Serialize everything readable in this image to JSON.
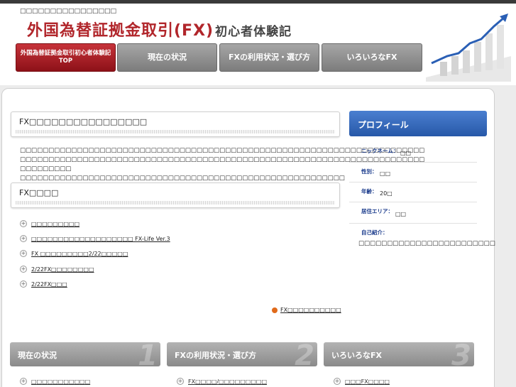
{
  "header": {
    "tagline": "□□□□□□□□□□□□□□□□",
    "logo_main": "外国為替証拠金取引(FX)",
    "logo_sub": "初心者体験記"
  },
  "nav": [
    {
      "label": "外国為替証拠金取引初心者体験記 TOP",
      "active": true
    },
    {
      "label": "現在の状況",
      "active": false
    },
    {
      "label": "FXの利用状況・選び方",
      "active": false
    },
    {
      "label": "いろいろなFX",
      "active": false
    }
  ],
  "intro_box": {
    "title": "FX□□□□□□□□□□□□□□□□",
    "lines": [
      "□□□□□□□□□□□□□□□□□□□□□□□□□□□□□□□□□□□□□□□□□□□□□□□□□□□□□□□□□□□□□□□□□□□□□□□",
      "□□□□□□□□□□□□□□□□□□□□□□□□□□□□□□□□□□□□□□□□□□□□□□□□□□□□□□□□□□□□□□□□□□□□□□□",
      "□□□□□□□□□ □□□□□□□□□□□□□□□□□□□□□□□□□□□□□□□□□□□□□□□□□□□□□□□□□□□□□□□□□"
    ]
  },
  "news_box": {
    "title": "FX□□□□",
    "items": [
      "□□□□□□□□□",
      "□□□□□□□□□□□□□□□□□□□ FX-Life Ver.3",
      "FX □□□□□□□□□2/22□□□□□",
      "2/22FX□□□□□□□□",
      "2/22FX□□□"
    ],
    "more_link": "FX□□□□□□□□□□"
  },
  "profile": {
    "title": "プロフィール",
    "rows": [
      {
        "label": "ニックネーム：",
        "value": "□□"
      },
      {
        "label": "性別：",
        "value": "□□"
      },
      {
        "label": "年齢：",
        "value": "20□"
      },
      {
        "label": "居住エリア：",
        "value": "□□"
      }
    ],
    "intro_label": "自己紹介：",
    "intro_text": "□□□□□□□□□□□□□□□□□□□□□□□□"
  },
  "categories": [
    {
      "label": "現在の状況",
      "num": "1",
      "item": "□□□□□□□□□□□"
    },
    {
      "label": "FXの利用状況・選び方",
      "num": "2",
      "item": "FX□□□□/□□□□□□□□□"
    },
    {
      "label": "いろいろなFX",
      "num": "3",
      "item": "□□□FX□□□□"
    }
  ]
}
